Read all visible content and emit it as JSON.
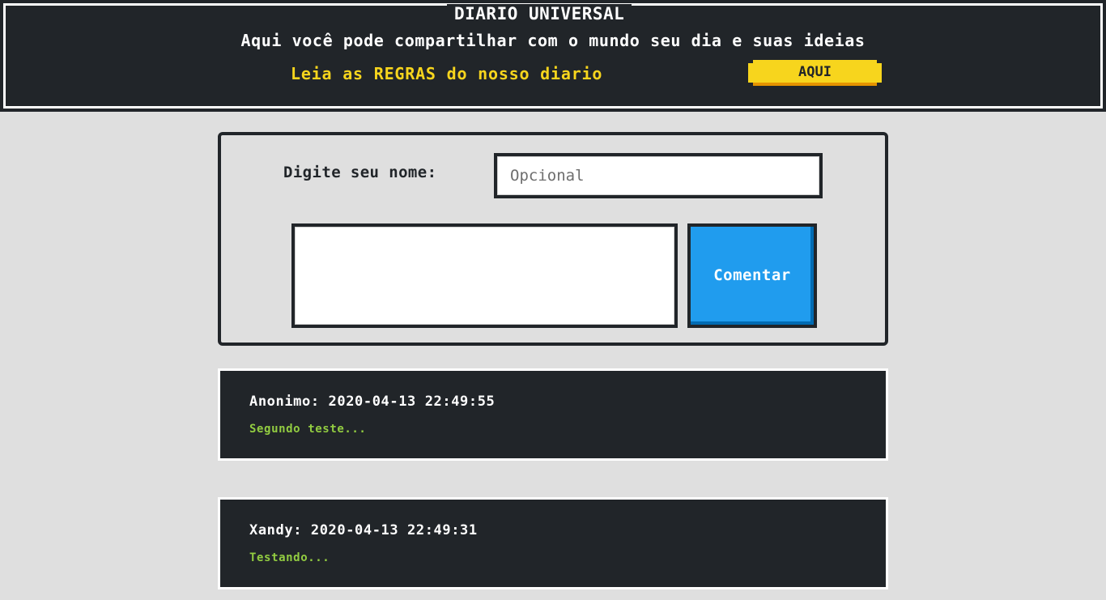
{
  "header": {
    "title": "DIARIO UNIVERSAL",
    "tagline": "Aqui você pode compartilhar com o mundo seu dia e suas ideias",
    "rules_text": "Leia as REGRAS do nosso diario",
    "rules_button_label": "AQUI"
  },
  "form": {
    "name_label": "Digite seu nome:",
    "name_placeholder": "Opcional",
    "comment_value": "",
    "submit_label": "Comentar"
  },
  "comments": [
    {
      "author": "Anonimo",
      "timestamp": "2020-04-13 22:49:55",
      "text": "Segundo teste..."
    },
    {
      "author": "Xandy",
      "timestamp": "2020-04-13 22:49:31",
      "text": "Testando..."
    }
  ],
  "colors": {
    "dark": "#212529",
    "background": "#dfdfdf",
    "accent_yellow": "#f7d51d",
    "button_blue": "#209cee",
    "comment_green": "#92cc41"
  }
}
